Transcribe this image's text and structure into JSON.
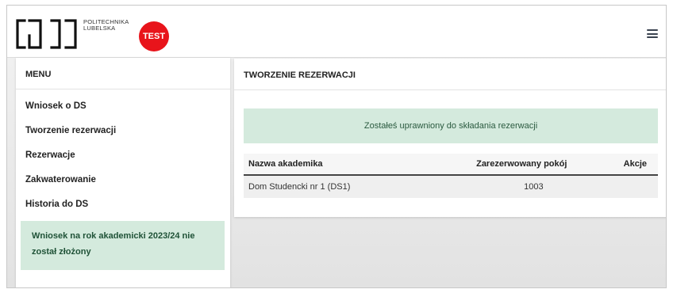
{
  "header": {
    "university_line1": "POLITECHNIKA",
    "university_line2": "LUBELSKA",
    "badge": "TEST"
  },
  "sidebar": {
    "title": "MENU",
    "items": [
      {
        "label": "Wniosek o DS"
      },
      {
        "label": "Tworzenie rezerwacji"
      },
      {
        "label": "Rezerwacje"
      },
      {
        "label": "Zakwaterowanie"
      },
      {
        "label": "Historia do DS"
      }
    ],
    "alert_line1": "Wniosek na rok akademicki 2023/24 nie",
    "alert_line2": "został złożony"
  },
  "main": {
    "title": "TWORZENIE REZERWACJI",
    "success_message": "Zostałeś uprawniony do składania rezerwacji",
    "table": {
      "columns": [
        "Nazwa akademika",
        "Zarezerwowany pokój",
        "Akcje"
      ],
      "rows": [
        {
          "dorm": "Dom Studencki nr 1 (DS1)",
          "room": "1003",
          "actions": ""
        }
      ]
    }
  },
  "colors": {
    "badge": "#e8141b",
    "alert_background": "#d4eadd",
    "alert_text": "#1f5237"
  },
  "icons": {
    "logo": "politechnika-lubelska-logo",
    "menu": "hamburger-icon"
  }
}
